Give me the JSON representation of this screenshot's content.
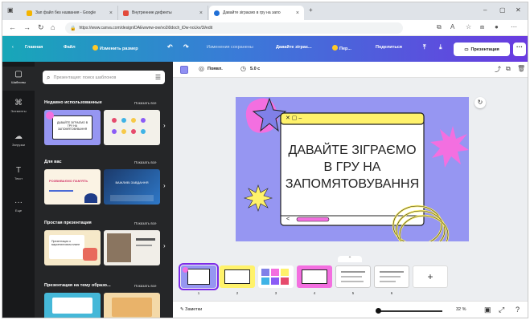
{
  "browser": {
    "tabs": [
      {
        "label": "Зап файл без названия - Google",
        "favicon_color": "#f4b400"
      },
      {
        "label": "Внутренние дефекты",
        "favicon_color": "#e24a3b"
      },
      {
        "label": "Давайте зіграємо в гру на запо",
        "favicon_color": "#1f6fd6"
      }
    ],
    "new_tab": "+",
    "url": "https://www.canva.com/design/DAEwwnw-ow/vo2i0doch_iDw-noLkv/3i/edit",
    "win_min": "–",
    "win_max": "▢",
    "win_close": "✕"
  },
  "header": {
    "back": "‹",
    "home": "Главная",
    "file": "Файл",
    "resize": "Изменить размер",
    "undo": "↶",
    "redo": "↷",
    "saved": "Изменения сохранены",
    "design_title": "Давайте зіграє...",
    "premium": "Пер...",
    "share": "Поделиться",
    "upload": "⤒",
    "download": "⤓",
    "present": "Презентация",
    "more": "···"
  },
  "rail": [
    {
      "icon": "▢",
      "label": "Шаблоны"
    },
    {
      "icon": "⌘",
      "label": "Элементы"
    },
    {
      "icon": "☁",
      "label": "Загрузки"
    },
    {
      "icon": "T",
      "label": "Текст"
    },
    {
      "icon": "···",
      "label": "Еще"
    }
  ],
  "panel": {
    "search_placeholder": "Презентация: поиск шаблонов",
    "sections": [
      {
        "title": "Недавно использованные",
        "see_all": "Показать все"
      },
      {
        "title": "Для вас",
        "see_all": "Показать все"
      },
      {
        "title": "Простая презентация",
        "see_all": "Показать все"
      },
      {
        "title": "Презентация на тему образо...",
        "see_all": "Показать все"
      }
    ],
    "template_texts": [
      "ДАВАЙТЕ ЗІГРАЄМО В ГРУ НА ЗАПОМЯТОВУВАННЯ",
      "РОЗВИВАЄМО ПАМ'ЯТЬ",
      "ВАЖЛИВІ ЗАВДАННЯ",
      "Презентация о маркетинговом плане"
    ]
  },
  "editor": {
    "anim": "Появл.",
    "duration": "5.0 с",
    "slide_title": "ДАВАЙТЕ ЗІГРАЄМО В ГРУ НА ЗАПОМЯТОВУВАННЯ",
    "slide_title_lines": [
      "ДАВАЙТЕ ЗІГРАЄМО",
      "В ГРУ НА",
      "ЗАПОМЯТОВУВАННЯ"
    ],
    "window_icons": "✕ ▢ –",
    "thumb_numbers": [
      "1",
      "2",
      "3",
      "4",
      "5",
      "6"
    ],
    "add_page": "+",
    "notes": "Заметки",
    "zoom": "32 %",
    "help": "?"
  },
  "colors": {
    "slide_bg": "#9696f2",
    "accent_purple": "#7d2ae8",
    "pink": "#f36fe0",
    "yellow": "#fff26b"
  }
}
